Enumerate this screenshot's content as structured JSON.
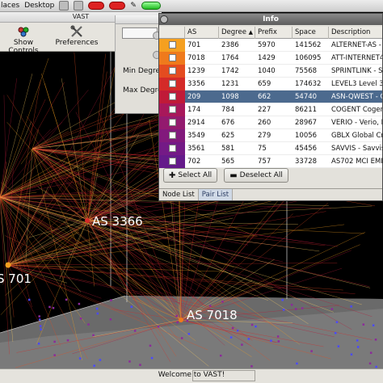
{
  "top_panel": {
    "places": "laces",
    "desktop": "Desktop"
  },
  "vast_window": {
    "title": "VAST"
  },
  "toolbar": {
    "show_controls": "Show Controls",
    "preferences": "Preferences"
  },
  "controls": {
    "min_degree_label": "Min Degree",
    "max_degree_label": "Max Degree"
  },
  "info_window": {
    "title": "Info",
    "columns": [
      "AS",
      "Degree",
      "Prefix",
      "Space",
      "Description"
    ],
    "sort_column": "Degree",
    "rows": [
      {
        "as": "701",
        "degree": "2386",
        "prefix": "5970",
        "space": "141562",
        "desc": "ALTERNET-AS - U",
        "color": "#f5a020",
        "selected": false
      },
      {
        "as": "7018",
        "degree": "1764",
        "prefix": "1429",
        "space": "106095",
        "desc": "ATT-INTERNET4 -",
        "color": "#ef7a1c",
        "selected": false
      },
      {
        "as": "1239",
        "degree": "1742",
        "prefix": "1040",
        "space": "75568",
        "desc": "SPRINTLINK - Sp",
        "color": "#e44c20",
        "selected": false
      },
      {
        "as": "3356",
        "degree": "1231",
        "prefix": "659",
        "space": "174632",
        "desc": "LEVEL3 Level 3",
        "color": "#d42a28",
        "selected": false
      },
      {
        "as": "209",
        "degree": "1098",
        "prefix": "662",
        "space": "54740",
        "desc": "ASN-QWEST - Q",
        "color": "#c01a38",
        "selected": true
      },
      {
        "as": "174",
        "degree": "784",
        "prefix": "227",
        "space": "86211",
        "desc": "COGENT Cogent",
        "color": "#a8185a",
        "selected": false
      },
      {
        "as": "2914",
        "degree": "676",
        "prefix": "260",
        "space": "28967",
        "desc": "VERIO - Verio, In",
        "color": "#931a6e",
        "selected": false
      },
      {
        "as": "3549",
        "degree": "625",
        "prefix": "279",
        "space": "10056",
        "desc": "GBLX Global Cro",
        "color": "#82197c",
        "selected": false
      },
      {
        "as": "3561",
        "degree": "581",
        "prefix": "75",
        "space": "45456",
        "desc": "SAVVIS - Savvis",
        "color": "#741a86",
        "selected": false
      },
      {
        "as": "702",
        "degree": "565",
        "prefix": "757",
        "space": "33728",
        "desc": "AS702 MCI EMEA",
        "color": "#651a8a",
        "selected": false
      }
    ],
    "select_all": "Select All",
    "deselect_all": "Deselect All",
    "tabs": [
      "Node List",
      "Pair List"
    ],
    "active_tab": "Pair List"
  },
  "view3d": {
    "labels": [
      {
        "text": "AS 3366"
      },
      {
        "text": "S 701"
      },
      {
        "text": "AS 7018"
      }
    ],
    "edge_colors": [
      "#f5a020",
      "#e44c20",
      "#d42a28",
      "#ffd060",
      "#b81a3a"
    ],
    "background": "#000000",
    "plane_color": "#7a7a7a"
  },
  "status_bar": {
    "text": "Welcome to VAST!"
  }
}
